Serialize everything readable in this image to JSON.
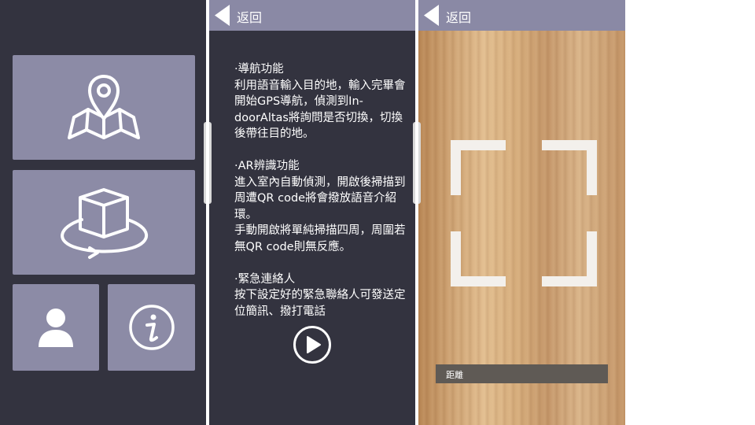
{
  "colors": {
    "panel_bg": "#33333f",
    "tile_bg": "#8c8ba6",
    "topbar_bg": "#8a89a5",
    "white": "#ffffff"
  },
  "menu": {
    "tiles": [
      {
        "icon": "map-pin-icon"
      },
      {
        "icon": "ar-cube-icon"
      },
      {
        "icon": "person-icon"
      },
      {
        "icon": "info-icon"
      }
    ]
  },
  "info_screen": {
    "back_label": "返回",
    "text": "·導航功能\n利用語音輸入目的地，輸入完畢會開始GPS導航，偵測到In-doorAltas將詢問是否切換，切換後帶往目的地。\n\n·AR辨識功能\n進入室內自動偵測，開啟後掃描到周遭QR code將會撥放語音介紹環。\n手動開啟將單純掃描四周，周圍若無QR code則無反應。\n\n·緊急連絡人\n按下設定好的緊急聯絡人可發送定位簡訊、撥打電話",
    "play_icon": "play-icon"
  },
  "scan_screen": {
    "back_label": "返回",
    "distance_label": "距離",
    "frame_icon": "scan-frame-icon"
  }
}
